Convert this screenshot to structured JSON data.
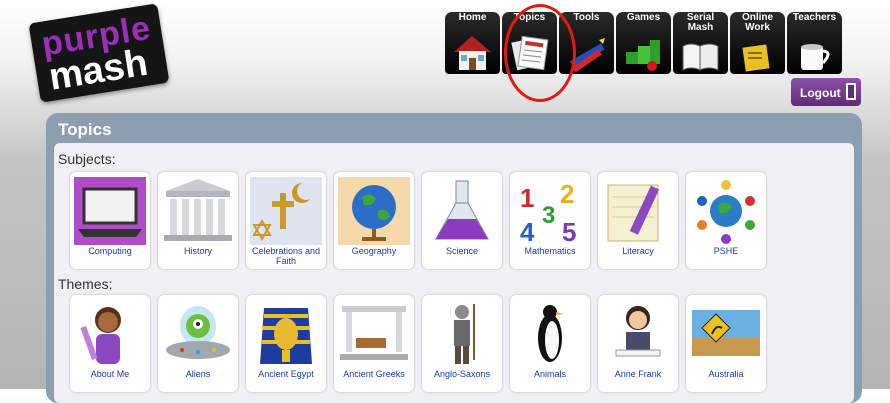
{
  "logo": {
    "line1": "purple",
    "line2": "mash"
  },
  "nav": [
    {
      "label": "Home",
      "icon": "house-icon"
    },
    {
      "label": "Topics",
      "icon": "newspaper-icon"
    },
    {
      "label": "Tools",
      "icon": "pencil-tools-icon"
    },
    {
      "label": "Games",
      "icon": "games-blocks-icon"
    },
    {
      "label": "Serial\nMash",
      "icon": "book-icon"
    },
    {
      "label": "Online\nWork",
      "icon": "folder-icon"
    },
    {
      "label": "Teachers",
      "icon": "mug-icon"
    }
  ],
  "logout": {
    "label": "Logout"
  },
  "panel": {
    "title": "Topics"
  },
  "subjects": {
    "heading": "Subjects:",
    "items": [
      "Computing",
      "History",
      "Celebrations and Faith",
      "Geography",
      "Science",
      "Mathematics",
      "Literacy",
      "PSHE"
    ]
  },
  "themes": {
    "heading": "Themes:",
    "items": [
      "About Me",
      "Aliens",
      "Ancient Egypt",
      "Ancient Greeks",
      "Anglo-Saxons",
      "Animals",
      "Anne Frank",
      "Australia"
    ]
  },
  "colors": {
    "accent": "#5d2d78",
    "highlight": "#e21a10",
    "link": "#1a3ca8",
    "panel": "#8c9fb1"
  }
}
